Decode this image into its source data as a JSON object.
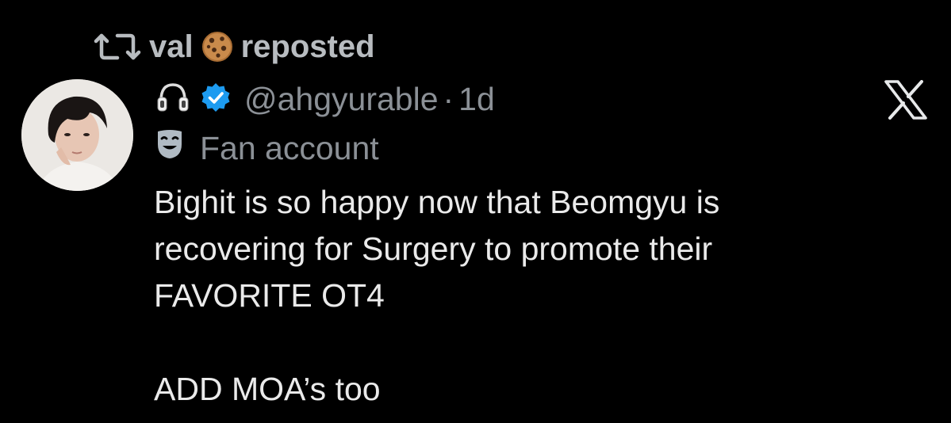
{
  "repost": {
    "icon": "repost-icon",
    "user_name": "val",
    "emoji": "cookie-emoji",
    "suffix": "reposted"
  },
  "author": {
    "avatar": "avatar",
    "name_icon": "headphones-emoji",
    "badge": "verified-badge-icon",
    "handle": "@ahgyurable",
    "separator": "·",
    "time": "1d"
  },
  "account_label": {
    "icon": "theater-mask-icon",
    "text": "Fan account"
  },
  "platform_logo": "x-logo-icon",
  "tweet": {
    "line1": "Bighit is so happy now that Beomgyu is\nrecovering for Surgery to promote their\nFAVORITE OT4",
    "line2": "ADD MOA’s too"
  },
  "colors": {
    "background": "#000000",
    "text": "#e7e9ea",
    "muted": "#8b9096",
    "verified": "#1d9bf0"
  }
}
